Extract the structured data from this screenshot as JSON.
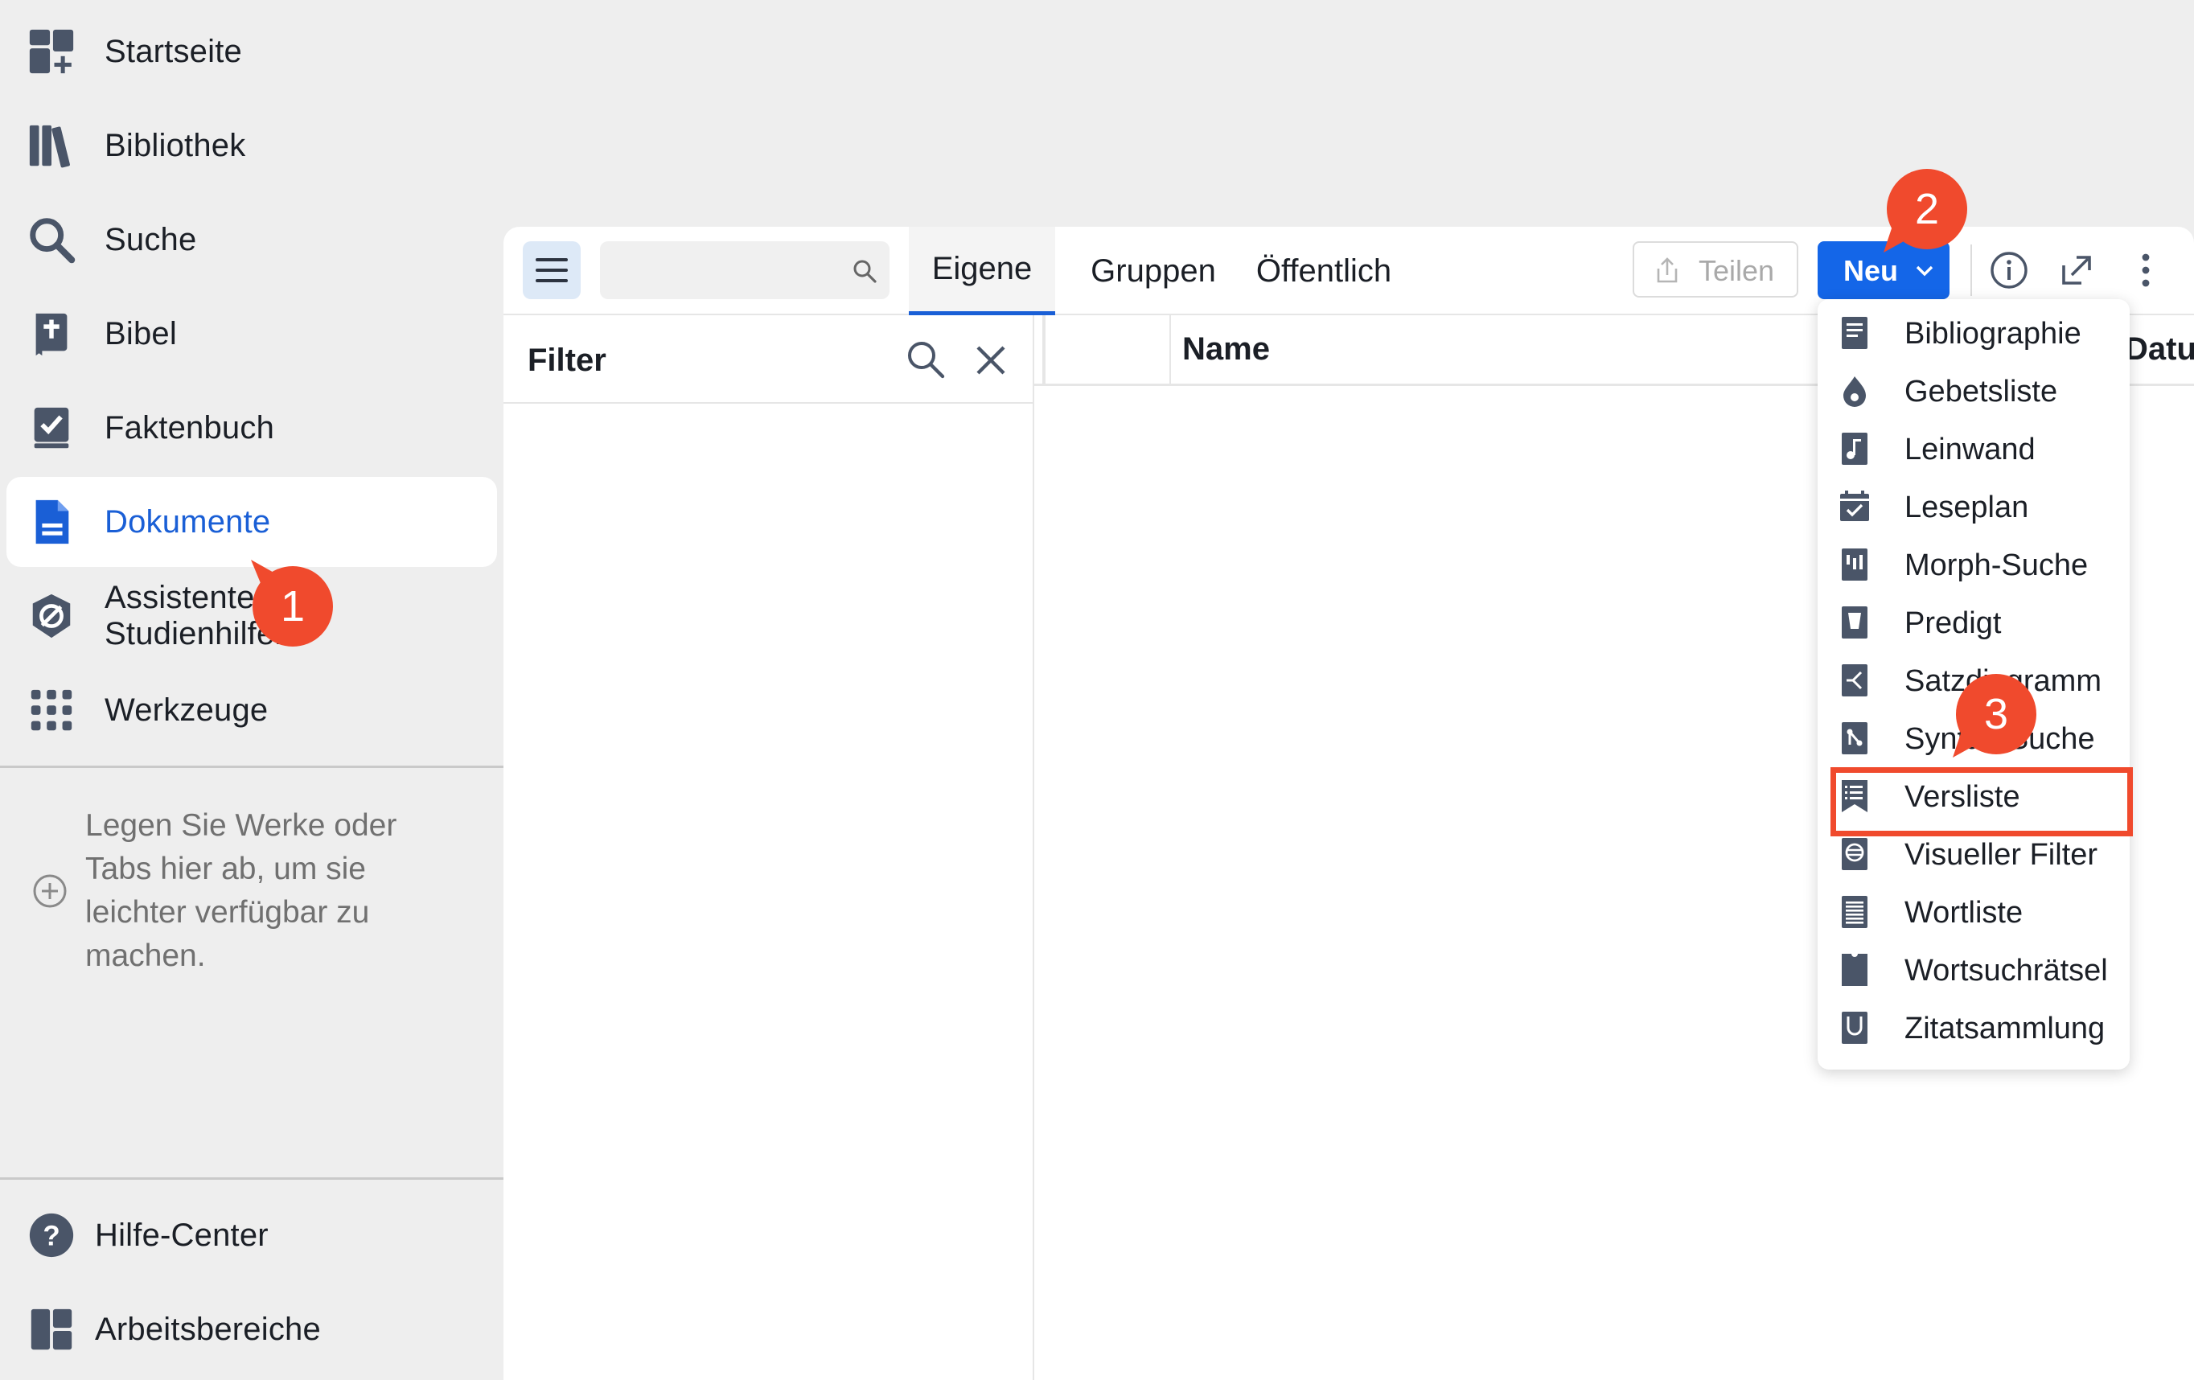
{
  "sidebar": {
    "items": [
      {
        "label": "Startseite"
      },
      {
        "label": "Bibliothek"
      },
      {
        "label": "Suche"
      },
      {
        "label": "Bibel"
      },
      {
        "label": "Faktenbuch"
      },
      {
        "label": "Dokumente"
      },
      {
        "label": "Assistenten & Studienhilfen"
      },
      {
        "label": "Werkzeuge"
      }
    ],
    "drop_hint": "Legen Sie Werke oder Tabs hier ab, um sie leichter verfügbar zu machen.",
    "bottom": [
      {
        "label": "Hilfe-Center"
      },
      {
        "label": "Arbeitsbereiche"
      }
    ]
  },
  "toolbar": {
    "search_placeholder": "",
    "tabs": [
      {
        "label": "Eigene"
      },
      {
        "label": "Gruppen"
      },
      {
        "label": "Öffentlich"
      }
    ],
    "share_label": "Teilen",
    "new_label": "Neu"
  },
  "filter": {
    "title": "Filter"
  },
  "list": {
    "columns": [
      "",
      "Name",
      "Datum"
    ]
  },
  "new_menu": {
    "items": [
      {
        "label": "Bibliographie"
      },
      {
        "label": "Gebetsliste"
      },
      {
        "label": "Leinwand"
      },
      {
        "label": "Leseplan"
      },
      {
        "label": "Morph-Suche"
      },
      {
        "label": "Predigt"
      },
      {
        "label": "Satzdiagramm"
      },
      {
        "label": "Syntax-Suche"
      },
      {
        "label": "Versliste"
      },
      {
        "label": "Visueller Filter"
      },
      {
        "label": "Wortliste"
      },
      {
        "label": "Wortsuchrätsel"
      },
      {
        "label": "Zitatsammlung"
      }
    ],
    "highlighted": "Versliste"
  },
  "annotations": {
    "step1": "1",
    "step2": "2",
    "step3": "3"
  },
  "colors": {
    "accent": "#1a5fd6",
    "button_blue": "#1466e8",
    "annotation_red": "#f04a2d",
    "icon_slate": "#4a5568"
  }
}
